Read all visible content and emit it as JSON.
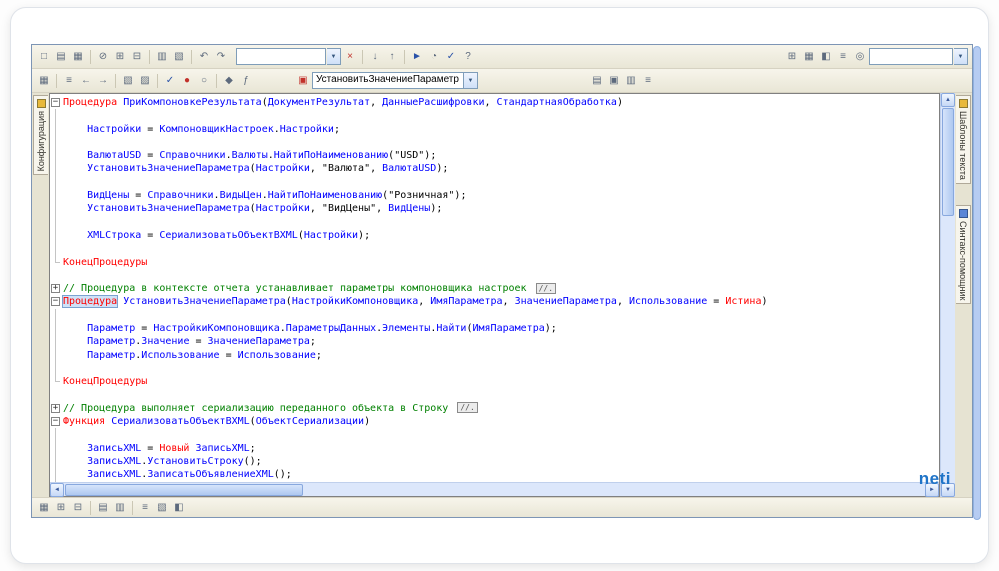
{
  "colors": {
    "keyword": "#ff0000",
    "identifier": "#0000ff",
    "comment": "#008000",
    "plain": "#000000",
    "string": "#000000",
    "accent_watermark": "#1f74c8"
  },
  "watermark": "neti",
  "toolbar1": {
    "left_icons": [
      {
        "n": "new-document",
        "g": "□"
      },
      {
        "n": "open-file",
        "g": "▤"
      },
      {
        "n": "save",
        "g": "▦"
      },
      "|",
      {
        "n": "cut",
        "g": "⊘"
      },
      {
        "n": "copy",
        "g": "⊞"
      },
      {
        "n": "paste",
        "g": "⊟"
      },
      "|",
      {
        "n": "print",
        "g": "▥"
      },
      {
        "n": "print-preview",
        "g": "▧"
      },
      "|",
      {
        "n": "undo",
        "g": "↶"
      },
      {
        "n": "redo",
        "g": "↷"
      }
    ],
    "search": {
      "value": ""
    },
    "mid_icons": [
      {
        "n": "clear-search",
        "g": "×",
        "c": "red"
      },
      "|",
      {
        "n": "find-next",
        "g": "↓"
      },
      {
        "n": "find-previous",
        "g": "↑"
      },
      "|",
      {
        "n": "start-debugging",
        "g": "►",
        "c": "blue"
      },
      {
        "n": "measure-performance",
        "g": "◔"
      },
      {
        "n": "syntax-check",
        "g": "✓",
        "c": "blue"
      },
      {
        "n": "help",
        "g": "?"
      }
    ],
    "right_icons": [
      {
        "n": "calculator",
        "g": "⊞"
      },
      {
        "n": "calendar",
        "g": "▦"
      },
      {
        "n": "compare-files",
        "g": "◧"
      },
      {
        "n": "service-options",
        "g": "≡"
      },
      {
        "n": "about",
        "g": "◎"
      }
    ],
    "right_input": {
      "value": ""
    }
  },
  "toolbar2": {
    "left_icons": [
      {
        "n": "save-module",
        "g": "▦"
      },
      "|",
      {
        "n": "format-block",
        "g": "≡"
      },
      {
        "n": "shift-left",
        "g": "←"
      },
      {
        "n": "shift-right",
        "g": "→"
      },
      "|",
      {
        "n": "comment-lines",
        "g": "▧"
      },
      {
        "n": "uncomment-lines",
        "g": "▨"
      },
      "|",
      {
        "n": "module-syntax-check",
        "g": "✓",
        "c": "blue"
      },
      {
        "n": "toggle-breakpoint",
        "g": "●",
        "c": "red"
      },
      {
        "n": "breakpoints-list",
        "g": "○"
      },
      "|",
      {
        "n": "go-to-definition",
        "g": "◆"
      },
      {
        "n": "procedures-functions-list",
        "g": "ƒ"
      }
    ],
    "proc_combo": {
      "value": "УстановитьЗначениеПараметр"
    },
    "right_icons": [
      {
        "n": "text-templates",
        "g": "▤"
      },
      {
        "n": "syntax-assistant",
        "g": "▣"
      },
      {
        "n": "code-formatting",
        "g": "▥"
      },
      {
        "n": "module-settings",
        "g": "≡"
      }
    ]
  },
  "left_tabs": [
    {
      "label": "Конфигурация"
    }
  ],
  "right_tabs": [
    {
      "label": "Шаблоны текста"
    },
    {
      "label": "Синтакс-помощник"
    }
  ],
  "bottom_icons": [
    {
      "n": "grid-view",
      "g": "▦"
    },
    {
      "n": "add-row",
      "g": "⊞"
    },
    {
      "n": "delete-row",
      "g": "⊟"
    },
    "|",
    {
      "n": "merge-cells",
      "g": "▤"
    },
    {
      "n": "split-cells",
      "g": "▥"
    },
    "|",
    {
      "n": "properties",
      "g": "≡"
    },
    {
      "n": "preview-layout",
      "g": "▧"
    },
    {
      "n": "layout-settings",
      "g": "◧"
    }
  ],
  "editor": {
    "lines": [
      {
        "f": "-",
        "s": [
          "k|Процедура",
          "o| ",
          "i|ПриКомпоновкеРезультата",
          "o|(",
          "i|ДокументРезультат",
          "o|, ",
          "i|ДанныеРасшифровки",
          "o|, ",
          "i|СтандартнаяОбработка",
          "o|)"
        ]
      },
      {
        "f": "|",
        "s": []
      },
      {
        "f": "|",
        "s": [
          "o|    ",
          "i|Настройки",
          "o| = ",
          "i|КомпоновщикНастроек",
          "o|.",
          "i|Настройки",
          "o|;"
        ]
      },
      {
        "f": "|",
        "s": []
      },
      {
        "f": "|",
        "s": [
          "o|    ",
          "i|ВалютаUSD",
          "o| = ",
          "i|Справочники",
          "o|.",
          "i|Валюты",
          "o|.",
          "i|НайтиПоНаименованию",
          "o|(",
          "s|\"USD\"",
          "o|);"
        ]
      },
      {
        "f": "|",
        "s": [
          "o|    ",
          "i|УстановитьЗначениеПараметра",
          "o|(",
          "i|Настройки",
          "o|, ",
          "s|\"Валюта\"",
          "o|, ",
          "i|ВалютаUSD",
          "o|);"
        ]
      },
      {
        "f": "|",
        "s": []
      },
      {
        "f": "|",
        "s": [
          "o|    ",
          "i|ВидЦены",
          "o| = ",
          "i|Справочники",
          "o|.",
          "i|ВидыЦен",
          "o|.",
          "i|НайтиПоНаименованию",
          "o|(",
          "s|\"Розничная\"",
          "o|);"
        ]
      },
      {
        "f": "|",
        "s": [
          "o|    ",
          "i|УстановитьЗначениеПараметра",
          "o|(",
          "i|Настройки",
          "o|, ",
          "s|\"ВидЦены\"",
          "o|, ",
          "i|ВидЦены",
          "o|);"
        ]
      },
      {
        "f": "|",
        "s": []
      },
      {
        "f": "|",
        "s": [
          "o|    ",
          "i|XMLСтрока",
          "o| = ",
          "i|СериализоватьОбъектВXML",
          "o|(",
          "i|Настройки",
          "o|);"
        ]
      },
      {
        "f": "|",
        "s": []
      },
      {
        "f": "L",
        "s": [
          "k|КонецПроцедуры"
        ]
      },
      {
        "f": "",
        "s": []
      },
      {
        "f": "+",
        "s": [
          "c|// Процедура в контексте отчета устанавливает параметры компоновщика настроек ",
          "b|//."
        ]
      },
      {
        "f": "-",
        "s": [
          "K|Процедура",
          "o| ",
          "i|УстановитьЗначениеПараметра",
          "o|(",
          "i|НастройкиКомпоновщика",
          "o|, ",
          "i|ИмяПараметра",
          "o|, ",
          "i|ЗначениеПараметра",
          "o|, ",
          "i|Использование",
          "o| = ",
          "k|Истина",
          "o|)"
        ]
      },
      {
        "f": "|",
        "s": []
      },
      {
        "f": "|",
        "s": [
          "o|    ",
          "i|Параметр",
          "o| = ",
          "i|НастройкиКомпоновщика",
          "o|.",
          "i|ПараметрыДанных",
          "o|.",
          "i|Элементы",
          "o|.",
          "i|Найти",
          "o|(",
          "i|ИмяПараметра",
          "o|);"
        ]
      },
      {
        "f": "|",
        "s": [
          "o|    ",
          "i|Параметр",
          "o|.",
          "i|Значение",
          "o| = ",
          "i|ЗначениеПараметра",
          "o|;"
        ]
      },
      {
        "f": "|",
        "s": [
          "o|    ",
          "i|Параметр",
          "o|.",
          "i|Использование",
          "o| = ",
          "i|Использование",
          "o|;"
        ]
      },
      {
        "f": "|",
        "s": []
      },
      {
        "f": "L",
        "s": [
          "k|КонецПроцедуры"
        ]
      },
      {
        "f": "",
        "s": []
      },
      {
        "f": "+",
        "s": [
          "c|// Процедура выполняет сериализацию переданного объекта в Строку ",
          "b|//."
        ]
      },
      {
        "f": "-",
        "s": [
          "k|Функция",
          "o| ",
          "i|СериализоватьОбъектВXML",
          "o|(",
          "i|ОбъектСериализации",
          "o|)"
        ]
      },
      {
        "f": "|",
        "s": []
      },
      {
        "f": "|",
        "s": [
          "o|    ",
          "i|ЗаписьXML",
          "o| = ",
          "k|Новый",
          "o| ",
          "i|ЗаписьXML",
          "o|;"
        ]
      },
      {
        "f": "|",
        "s": [
          "o|    ",
          "i|ЗаписьXML",
          "o|.",
          "i|УстановитьСтроку",
          "o|();"
        ]
      },
      {
        "f": "|",
        "s": [
          "o|    ",
          "i|ЗаписьXML",
          "o|.",
          "i|ЗаписатьОбъявлениеXML",
          "o|();"
        ]
      }
    ]
  }
}
